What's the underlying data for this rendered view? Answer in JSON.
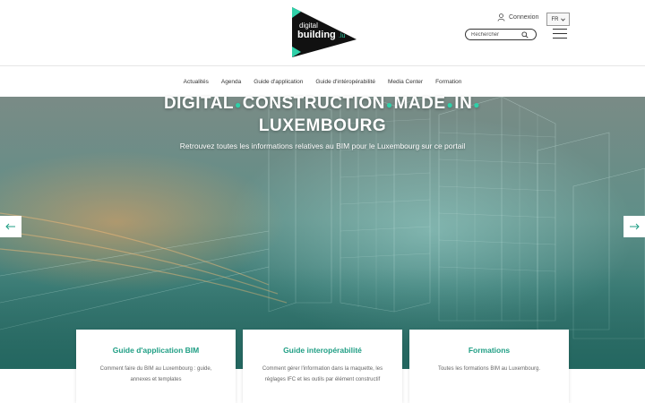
{
  "header": {
    "logo_top": "digital",
    "logo_main": "building",
    "logo_suffix": ".lu",
    "login_label": "Connexion",
    "lang_label": "FR",
    "search_placeholder": "Rechercher"
  },
  "nav": {
    "items": [
      {
        "label": "Actualités"
      },
      {
        "label": "Agenda"
      },
      {
        "label": "Guide d'application"
      },
      {
        "label": "Guide d'intéropérabilité"
      },
      {
        "label": "Media Center"
      },
      {
        "label": "Formation"
      }
    ]
  },
  "hero": {
    "title_words": [
      "DIGITAL",
      "CONSTRUCTION",
      "MADE",
      "IN",
      "LUXEMBOURG"
    ],
    "subtitle": "Retrouvez toutes les informations relatives au BIM pour le Luxembourg sur ce portail"
  },
  "cards": [
    {
      "title": "Guide d'application BIM",
      "desc": "Comment faire du BIM au Luxembourg : guide, annexes et templates"
    },
    {
      "title": "Guide interopérabilité",
      "desc": "Comment gérer l'information dans la maquette, les réglages IFC et les outils par élément constructif"
    },
    {
      "title": "Formations",
      "desc": "Toutes les formations BIM au Luxembourg."
    }
  ],
  "colors": {
    "accent": "#1f9e84",
    "dot": "#2fd0a8",
    "logo_green": "#2fd0a8"
  },
  "icons": {
    "login": "user-icon",
    "search": "search-icon",
    "menu": "hamburger-icon",
    "prev": "arrow-left-icon",
    "next": "arrow-right-icon",
    "lang": "chevron-down-icon"
  }
}
